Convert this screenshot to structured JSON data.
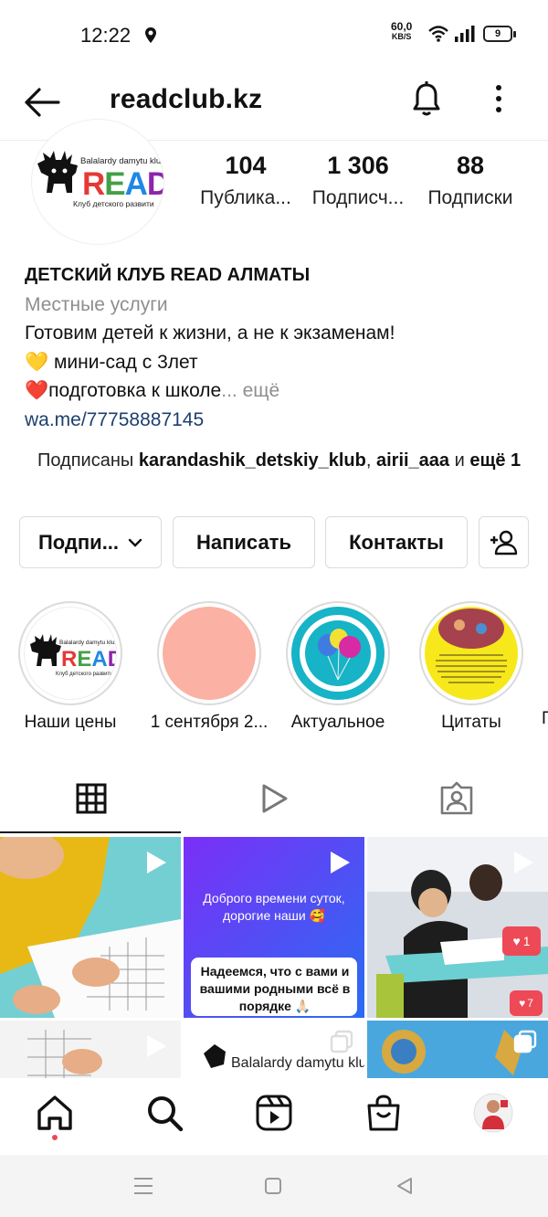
{
  "status_bar": {
    "time": "12:22",
    "speed_value": "60,0",
    "speed_unit": "KB/S",
    "battery": "9"
  },
  "header": {
    "username": "readclub.kz"
  },
  "profile": {
    "avatar_brand_top": "Balalardy damytu kluby",
    "avatar_brand_main": "READ",
    "avatar_brand_sub": "Клуб детского развити",
    "stats": [
      {
        "value": "104",
        "label": "Публика..."
      },
      {
        "value": "1 306",
        "label": "Подписч..."
      },
      {
        "value": "88",
        "label": "Подписки"
      }
    ],
    "name": "ДЕТСКИЙ КЛУБ READ АЛМАТЫ",
    "category": "Местные услуги",
    "bio_line1": "Готовим детей к жизни, а не к экзаменам!",
    "bio_line2": "💛 мини-сад с 3лет",
    "bio_line3": "❤️подготовка к школе",
    "bio_more": "... ещё",
    "link": "wa.me/77758887145",
    "followed_prefix": "Подписаны ",
    "followed_user1": "karandashik_detskiy_klub",
    "followed_sep": ", ",
    "followed_user2": "airii_aaa",
    "followed_and": " и ",
    "followed_more": "ещё 1"
  },
  "actions": {
    "follow_label": "Подпи...",
    "message_label": "Написать",
    "contacts_label": "Контакты"
  },
  "highlights": [
    {
      "label": "Наши цены"
    },
    {
      "label": "1 сентября 2..."
    },
    {
      "label": "Актуальное"
    },
    {
      "label": "Цитаты"
    }
  ],
  "posts": {
    "post2_text1": "Доброго времени суток, дорогие наши 🥰",
    "post2_text2": "Надеемся, что с вами и вашими родными всё в порядке 🙏🏻",
    "post3_like1": "1",
    "post3_like2": "7",
    "post5_text": "Balalardy damytu klu"
  },
  "colors": {
    "link": "#1d3f6e",
    "muted": "#8e8e8e",
    "border": "#dbdbdb"
  }
}
